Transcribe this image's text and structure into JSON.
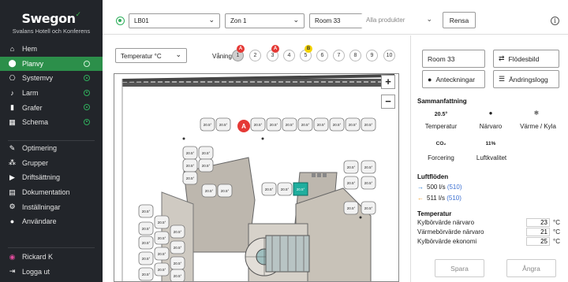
{
  "brand": {
    "name": "Swegon",
    "tick": "✓",
    "subtitle": "Svalans Hotell och Konferens"
  },
  "nav": {
    "primary": [
      {
        "icon": "home-icon",
        "label": "Hem",
        "glyph": "⌂",
        "dot": false
      },
      {
        "icon": "map-pin-icon",
        "label": "Planvy",
        "glyph": "⬤",
        "dot": true,
        "active": true
      },
      {
        "icon": "system-icon",
        "label": "Systemvy",
        "glyph": "⎔",
        "dot": true
      },
      {
        "icon": "bell-icon",
        "label": "Larm",
        "glyph": "♪",
        "dot": true
      },
      {
        "icon": "chart-icon",
        "label": "Grafer",
        "glyph": "▮",
        "dot": true
      },
      {
        "icon": "calendar-icon",
        "label": "Schema",
        "glyph": "▦",
        "dot": true
      }
    ],
    "secondary": [
      {
        "icon": "wrench-icon",
        "label": "Optimering",
        "glyph": "✎"
      },
      {
        "icon": "groups-icon",
        "label": "Grupper",
        "glyph": "⁂"
      },
      {
        "icon": "play-icon",
        "label": "Driftsättning",
        "glyph": "▶"
      },
      {
        "icon": "document-icon",
        "label": "Dokumentation",
        "glyph": "▤"
      },
      {
        "icon": "settings-icon",
        "label": "Inställningar",
        "glyph": "⚙"
      },
      {
        "icon": "user-icon",
        "label": "Användare",
        "glyph": "●"
      }
    ],
    "user": {
      "label": "Rickard K",
      "glyph": "◉"
    },
    "logout": {
      "label": "Logga ut",
      "glyph": "⇥"
    }
  },
  "topbar": {
    "unit": "LB01",
    "zone": "Zon 1",
    "room": "Room 33",
    "products_placeholder": "Alla produkter",
    "clear": "Rensa",
    "info": "i"
  },
  "main": {
    "measure": "Temperatur °C",
    "floor_label": "Våning",
    "floors": [
      "1",
      "2",
      "3",
      "4",
      "5",
      "6",
      "7",
      "8",
      "9",
      "10"
    ],
    "current_floor": "1",
    "badges": [
      {
        "floor": "1",
        "text": "A",
        "color": "#e53935"
      },
      {
        "floor": "3",
        "text": "A",
        "color": "#e53935"
      },
      {
        "floor": "5",
        "text": "B",
        "color": "#f4d300"
      }
    ],
    "zoom_in": "+",
    "zoom_out": "−",
    "alarm": {
      "text": "A",
      "color": "#e53935"
    },
    "room_value": "20.5°"
  },
  "rpanel": {
    "room_name": "Room 33",
    "flow_btn": "Flödesbild",
    "notes_btn": "Anteckningar",
    "log_btn": "Ändringslogg",
    "summary_title": "Sammanfattning",
    "summary": [
      {
        "value": "20.5°",
        "label": "Temperatur"
      },
      {
        "value": "",
        "label": "Närvaro",
        "icon": "person-icon",
        "glyph": "●"
      },
      {
        "value": "",
        "label": "Värme / Kyla",
        "icon": "snowflake-icon",
        "glyph": "❄"
      },
      {
        "value": "CO₂",
        "label": "Forcering"
      },
      {
        "value": "11%",
        "label": "Luftkvalitet"
      }
    ],
    "airflow_title": "Luftflöden",
    "airflows": [
      {
        "value": "500 l/s",
        "ref": "(510)",
        "color": "#1976d2",
        "arrow": "→"
      },
      {
        "value": "511 l/s",
        "ref": "(510)",
        "color": "#f29a1f",
        "arrow": "←"
      }
    ],
    "temp_title": "Temperatur",
    "temp_rows": [
      {
        "label": "Kylbörvärde närvaro",
        "value": "23",
        "unit": "°C"
      },
      {
        "label": "Värmebörvärde närvaro",
        "value": "21",
        "unit": "°C"
      },
      {
        "label": "Kylbörvärde ekonomi",
        "value": "25",
        "unit": "°C"
      }
    ],
    "save": "Spara",
    "undo": "Ångra"
  }
}
